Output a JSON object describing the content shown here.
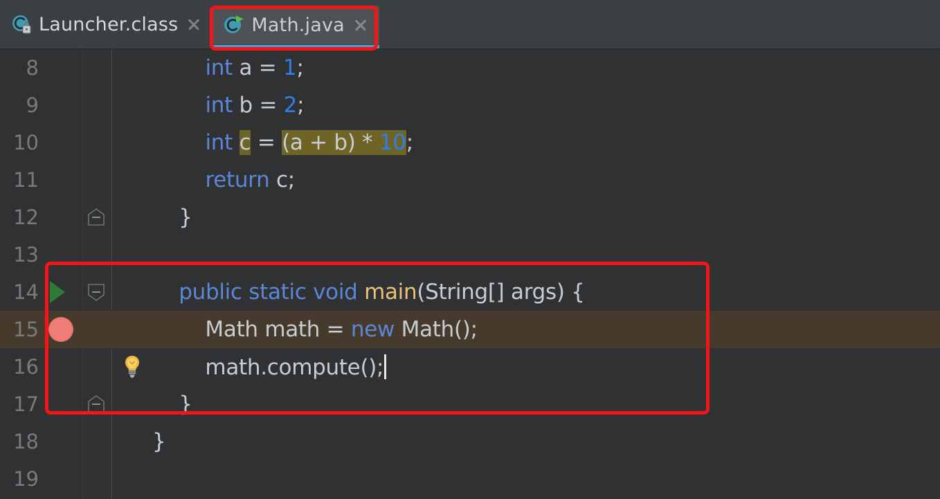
{
  "window": {
    "app": "IntelliJ IDEA editor",
    "theme_bg": "#2f3133",
    "accent": "#4a9fd4",
    "annotation_color": "#f41616"
  },
  "tabs": [
    {
      "label": "Launcher.class",
      "icon": "java-class-locked-icon",
      "active": false,
      "close_icon": "close-icon"
    },
    {
      "label": "Math.java",
      "icon": "java-class-runnable-icon",
      "active": true,
      "close_icon": "close-icon"
    }
  ],
  "editor": {
    "first_visible_line": 8,
    "last_visible_line": 19,
    "caret_line": 16,
    "breakpoint_line": 15,
    "run_marker_line": 14,
    "intention_bulb_line": 16,
    "highlight_color": "#6e6425",
    "breakpoint_line_color": "#463a2c",
    "lines": [
      {
        "number": "8",
        "segments": [
          {
            "text": "        ",
            "cls": "pl"
          },
          {
            "text": "int",
            "cls": "kw"
          },
          {
            "text": " a = ",
            "cls": "pl"
          },
          {
            "text": "1",
            "cls": "num"
          },
          {
            "text": ";",
            "cls": "pl"
          }
        ]
      },
      {
        "number": "9",
        "segments": [
          {
            "text": "        ",
            "cls": "pl"
          },
          {
            "text": "int",
            "cls": "kw"
          },
          {
            "text": " b = ",
            "cls": "pl"
          },
          {
            "text": "2",
            "cls": "num"
          },
          {
            "text": ";",
            "cls": "pl"
          }
        ]
      },
      {
        "number": "10",
        "segments": [
          {
            "text": "        ",
            "cls": "pl"
          },
          {
            "text": "int",
            "cls": "kw"
          },
          {
            "text": " ",
            "cls": "pl"
          },
          {
            "text": "c",
            "cls": "pl hl"
          },
          {
            "text": " = ",
            "cls": "pl"
          },
          {
            "text": "(a + b) * ",
            "cls": "pl hl"
          },
          {
            "text": "10",
            "cls": "num hl"
          },
          {
            "text": ";",
            "cls": "pl"
          }
        ]
      },
      {
        "number": "11",
        "segments": [
          {
            "text": "        ",
            "cls": "pl"
          },
          {
            "text": "return",
            "cls": "kw"
          },
          {
            "text": " c;",
            "cls": "pl"
          }
        ]
      },
      {
        "number": "12",
        "fold": true,
        "segments": [
          {
            "text": "    }",
            "cls": "pl"
          }
        ]
      },
      {
        "number": "13",
        "segments": []
      },
      {
        "number": "14",
        "run_marker": true,
        "fold": true,
        "segments": [
          {
            "text": "    ",
            "cls": "pl"
          },
          {
            "text": "public static void ",
            "cls": "kw"
          },
          {
            "text": "main",
            "cls": "mth"
          },
          {
            "text": "(String[] args) {",
            "cls": "pl"
          }
        ]
      },
      {
        "number": "15",
        "breakpoint": true,
        "bp_line": true,
        "segments": [
          {
            "text": "        Math math = ",
            "cls": "pl"
          },
          {
            "text": "new",
            "cls": "kw"
          },
          {
            "text": " Math();",
            "cls": "pl"
          }
        ]
      },
      {
        "number": "16",
        "bulb": true,
        "caret": true,
        "segments": [
          {
            "text": "        math.compute();",
            "cls": "pl"
          }
        ]
      },
      {
        "number": "17",
        "fold": true,
        "segments": [
          {
            "text": "    }",
            "cls": "pl"
          }
        ]
      },
      {
        "number": "18",
        "segments": [
          {
            "text": "}",
            "cls": "pl"
          }
        ]
      },
      {
        "number": "19",
        "segments": []
      }
    ]
  },
  "annotations": [
    {
      "name": "math-java-tab-highlight",
      "target": "Math.java tab"
    },
    {
      "name": "main-method-highlight",
      "target": "main method block lines 14-17"
    }
  ]
}
